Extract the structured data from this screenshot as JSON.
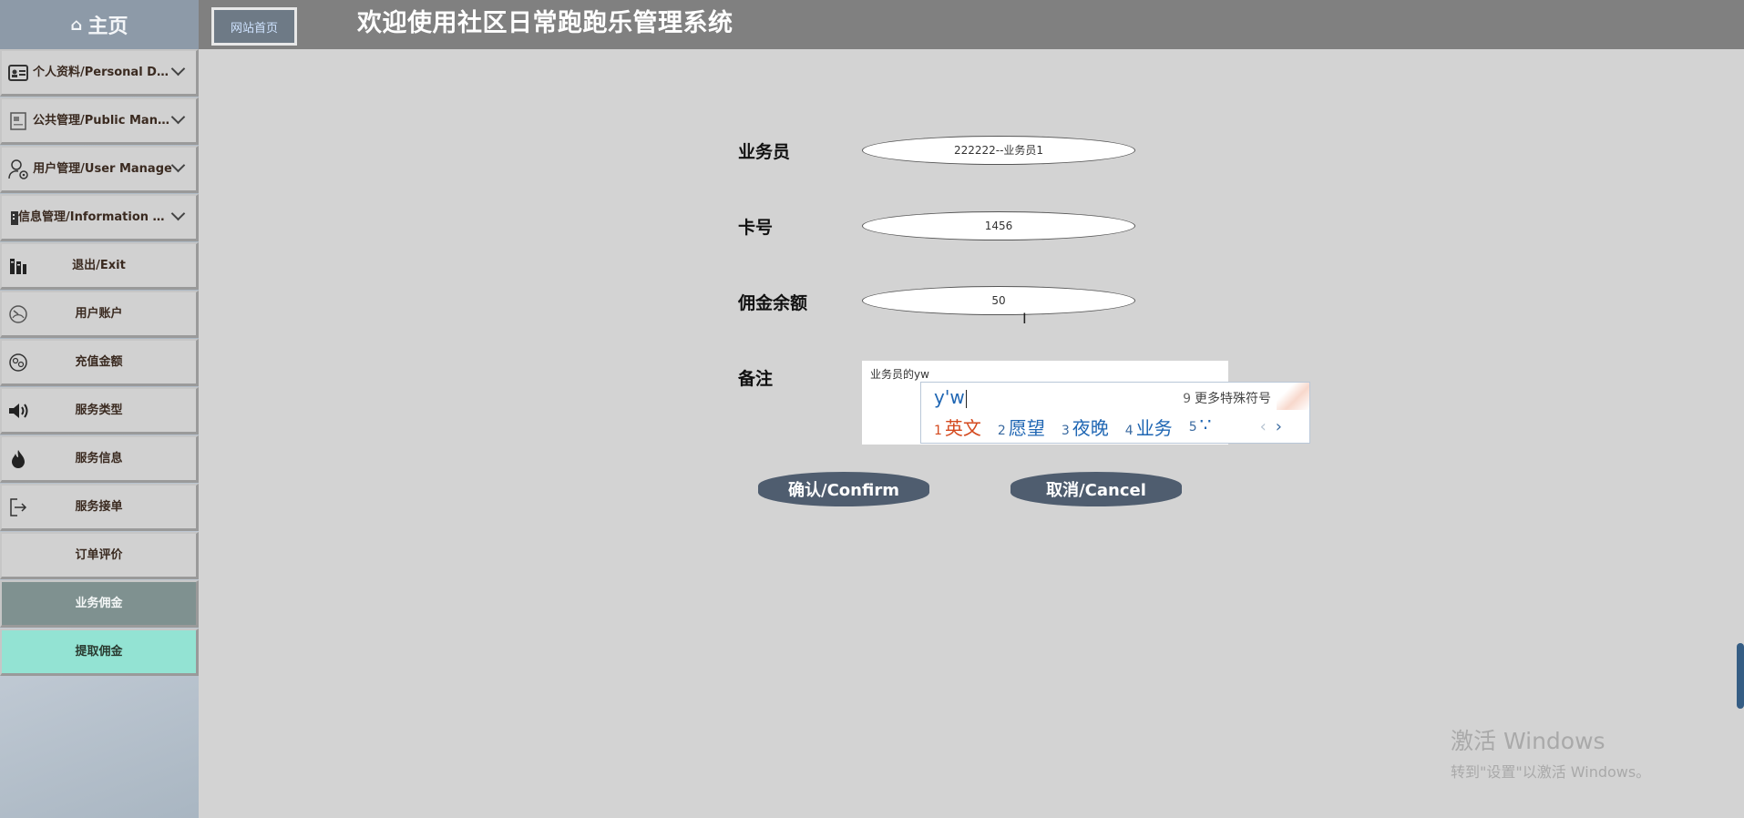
{
  "header": {
    "home_label": "主页",
    "home_icon": "home-icon",
    "site_home_button": "网站首页",
    "title": "欢迎使用社区日常跑跑乐管理系统"
  },
  "sidebar": {
    "items": [
      {
        "label": "个人资料/Personal Data",
        "icon": "id-card-icon",
        "expandable": true
      },
      {
        "label": "公共管理/Public Manage",
        "icon": "document-icon",
        "expandable": true
      },
      {
        "label": "用户管理/User Manage",
        "icon": "user-gear-icon",
        "expandable": true
      },
      {
        "label": "信息管理/Information Man...",
        "icon": "building-icon",
        "expandable": true
      },
      {
        "label": "退出/Exit",
        "icon": "books-icon",
        "expandable": false
      },
      {
        "label": "用户账户",
        "icon": "gauge-icon",
        "expandable": false
      },
      {
        "label": "充值金额",
        "icon": "coin-icon",
        "expandable": false
      },
      {
        "label": "服务类型",
        "icon": "speaker-icon",
        "expandable": false
      },
      {
        "label": "服务信息",
        "icon": "flame-icon",
        "expandable": false
      },
      {
        "label": "服务接单",
        "icon": "logout-icon",
        "expandable": false
      },
      {
        "label": "订单评价",
        "icon": "",
        "expandable": false
      },
      {
        "label": "业务佣金",
        "icon": "",
        "expandable": false,
        "state": "active"
      },
      {
        "label": "提取佣金",
        "icon": "",
        "expandable": false,
        "state": "highlight"
      }
    ]
  },
  "form": {
    "salesman_label": "业务员",
    "salesman_value": "222222--业务员1",
    "card_label": "卡号",
    "card_value": "1456",
    "balance_label": "佣金余额",
    "balance_value": "50",
    "remark_label": "备注",
    "remark_value": "业务员的yw",
    "confirm_label": "确认/Confirm",
    "cancel_label": "取消/Cancel"
  },
  "ime": {
    "composing": "y'w",
    "more_num": "9",
    "more_label": "更多特殊符号",
    "candidates": [
      {
        "num": "1",
        "text": "英文"
      },
      {
        "num": "2",
        "text": "愿望"
      },
      {
        "num": "3",
        "text": "夜晚"
      },
      {
        "num": "4",
        "text": "业务"
      },
      {
        "num": "5",
        "text": "∵"
      }
    ],
    "prev": "‹",
    "next": "›"
  },
  "watermark": {
    "line1": "激活 Windows",
    "line2": "转到\"设置\"以激活 Windows。"
  },
  "colors": {
    "header_bg": "#808080",
    "active_item": "#7f9190",
    "highlight_item": "#93e3d3",
    "button_bg": "#4f5d6f"
  }
}
